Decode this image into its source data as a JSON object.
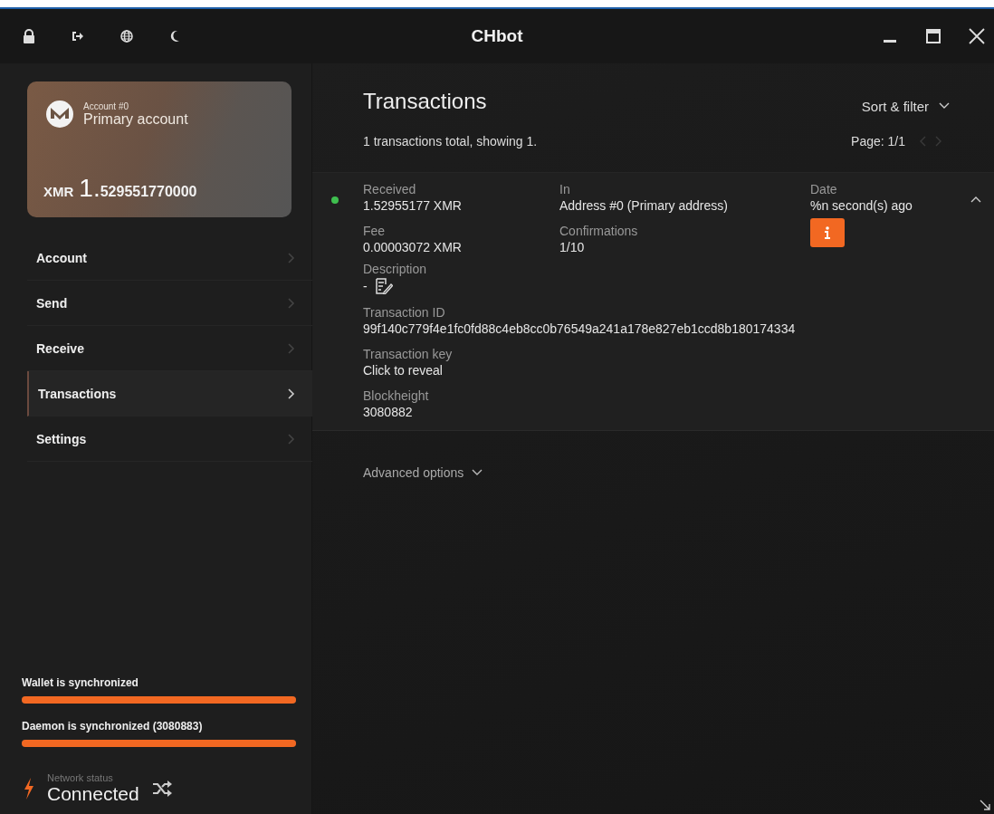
{
  "window": {
    "title": "CHbot"
  },
  "account_card": {
    "label": "Account #0",
    "name": "Primary account",
    "currency": "XMR",
    "balance_int": "1.",
    "balance_frac": "529551770000"
  },
  "menu": [
    {
      "label": "Account",
      "selected": false
    },
    {
      "label": "Send",
      "selected": false
    },
    {
      "label": "Receive",
      "selected": false
    },
    {
      "label": "Transactions",
      "selected": true
    },
    {
      "label": "Settings",
      "selected": false
    }
  ],
  "sync": [
    {
      "label": "Wallet is synchronized",
      "level": 1
    },
    {
      "label": "Daemon is synchronized (3080883)",
      "level": 1
    }
  ],
  "network": {
    "label": "Network status",
    "value": "Connected"
  },
  "transactions": {
    "title": "Transactions",
    "sort_filter": "Sort & filter",
    "summary": "1 transactions total, showing 1.",
    "page": "Page: 1/1",
    "items": [
      {
        "color": "#3fbf4f",
        "expanded": true,
        "fields": [
          {
            "label": "Received",
            "value": "1.52955177 XMR",
            "kind": "text"
          },
          {
            "label": "In",
            "value": "Address #0 (Primary address)",
            "kind": "text"
          },
          {
            "label": "Date",
            "value": "%n second(s) ago",
            "kind": "text"
          },
          {
            "label": "Fee",
            "value": "0.00003072 XMR",
            "kind": "text"
          },
          {
            "label": "Confirmations",
            "value": "1/10",
            "kind": "text"
          },
          {
            "kind": "info"
          },
          {
            "label": "Description",
            "value": "-",
            "kind": "edit"
          },
          {
            "label": "Transaction ID",
            "value": "99f140c779f4e1fc0fd88c4eb8cc0b76549a241a178e827eb1ccd8b180174334",
            "kind": "wide"
          },
          {
            "label": "Transaction key",
            "value": "Click to reveal",
            "kind": "link"
          },
          {
            "label": "Blockheight",
            "value": "3080882",
            "kind": "wide"
          }
        ]
      }
    ]
  },
  "advanced_options": "Advanced options"
}
